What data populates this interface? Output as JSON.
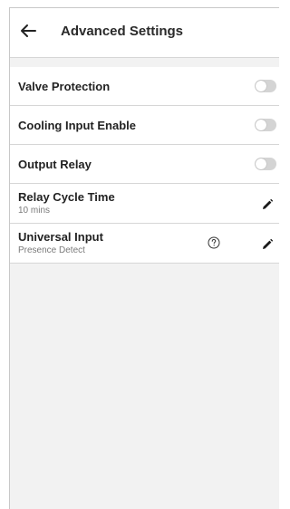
{
  "header": {
    "title": "Advanced Settings",
    "back_icon": "arrow-left-icon"
  },
  "settings": [
    {
      "label": "Valve Protection",
      "control": "toggle",
      "enabled": false
    },
    {
      "label": "Cooling Input Enable",
      "control": "toggle",
      "enabled": false
    },
    {
      "label": "Output Relay",
      "control": "toggle",
      "enabled": false
    },
    {
      "label": "Relay Cycle Time",
      "value": "10 mins",
      "control": "edit",
      "icon": "pencil-icon"
    },
    {
      "label": "Universal Input",
      "value": "Presence Detect",
      "control": "edit",
      "icon": "pencil-icon",
      "help_icon": "question-circle-icon"
    }
  ],
  "colors": {
    "background": "#f2f2f2",
    "surface": "#ffffff",
    "toggle_off": "#d4d4d4",
    "text_primary": "#222222",
    "text_secondary": "#7a7a7a"
  }
}
